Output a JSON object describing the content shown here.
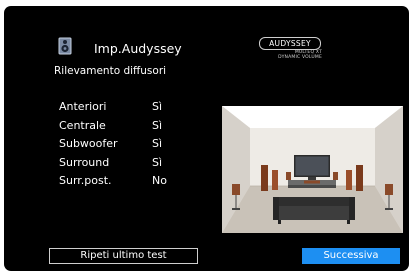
{
  "header": {
    "title": "Imp.Audyssey",
    "subtitle": "Rilevamento diffusori",
    "icon": "speaker-icon"
  },
  "logo": {
    "brand": "AUDYSSEY",
    "line1": "MULTEQ XT",
    "line2": "DYNAMIC VOLUME"
  },
  "detection": [
    {
      "label": "Anteriori",
      "value": "Sì"
    },
    {
      "label": "Centrale",
      "value": "Sì"
    },
    {
      "label": "Subwoofer",
      "value": "Sì"
    },
    {
      "label": "Surround",
      "value": "Sì"
    },
    {
      "label": "Surr.post.",
      "value": "No"
    }
  ],
  "buttons": {
    "repeat_label": "Ripeti ultimo test",
    "next_label": "Successiva"
  },
  "colors": {
    "background": "#000000",
    "accent": "#1d8ff2",
    "text": "#ffffff"
  }
}
